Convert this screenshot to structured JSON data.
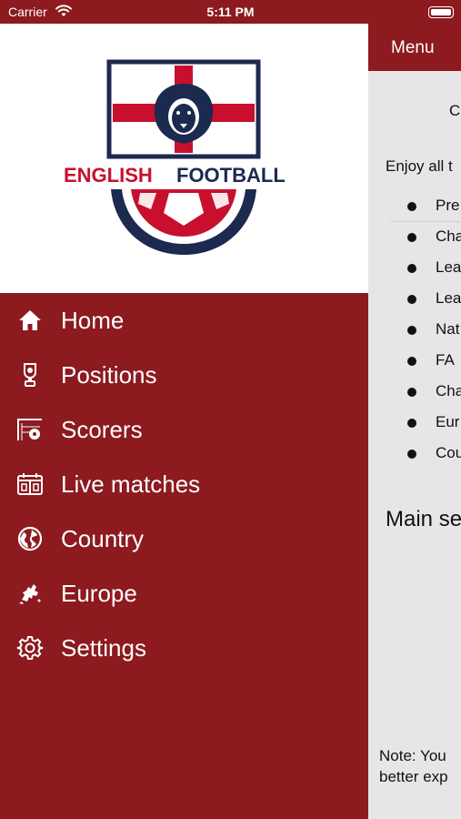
{
  "status_bar": {
    "carrier": "Carrier",
    "time": "5:11 PM"
  },
  "content": {
    "header": {
      "menu_label": "Menu"
    },
    "intro_fragment": "C",
    "enjoy_fragment": "Enjoy all t",
    "bullets": [
      "Pre",
      "Cha",
      "Lea",
      "Lea",
      "Nat",
      "FA",
      "Cha",
      "Eur",
      "Cou"
    ],
    "section_fragment": "Main se",
    "note_line1": "Note: You",
    "note_line2": "better exp"
  },
  "drawer": {
    "logo": {
      "text_left": "ENGLISH",
      "text_right": "FOOTBALL"
    },
    "items": [
      {
        "label": "Home",
        "icon": "home-icon"
      },
      {
        "label": "Positions",
        "icon": "trophy-icon"
      },
      {
        "label": "Scorers",
        "icon": "goal-icon"
      },
      {
        "label": "Live matches",
        "icon": "scoreboard-icon"
      },
      {
        "label": "Country",
        "icon": "globe-icon"
      },
      {
        "label": "Europe",
        "icon": "europe-map-icon"
      },
      {
        "label": "Settings",
        "icon": "gear-icon"
      }
    ]
  },
  "colors": {
    "primary": "#8c1a1f",
    "logo_red": "#c8102e",
    "logo_navy": "#1b2a4e"
  }
}
